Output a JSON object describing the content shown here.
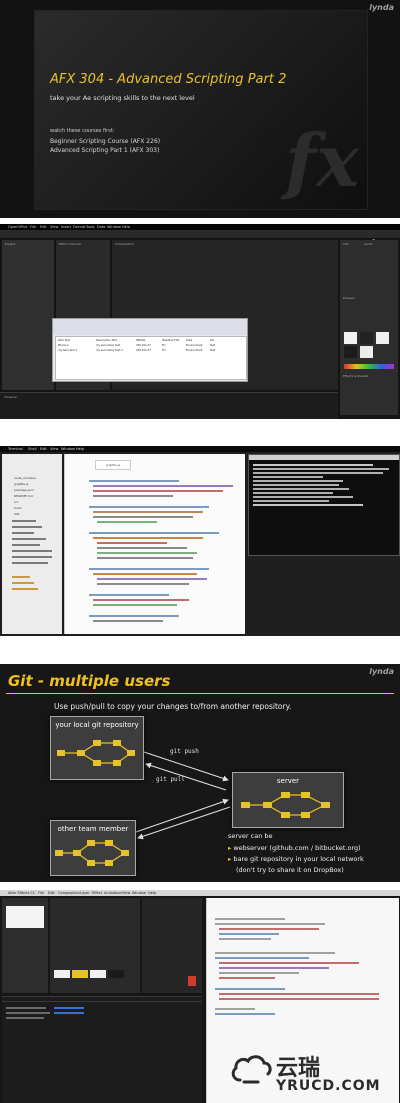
{
  "brand_badge": "lynda",
  "panels": {
    "intro": {
      "title": "AFX 304 - Advanced Scripting Part 2",
      "subtitle": "take your Ae scripting skills to the next level",
      "watch_prompt": "watch these courses first:",
      "courses": [
        "Beginner Scripting Course (AFX 226)",
        "Advanced Scripting Part 1 (AFX 303)"
      ],
      "watermark": "fx",
      "accent": "#e8c22a"
    },
    "spreadsheet": {
      "menu": [
        "OpenOffice",
        "File",
        "Edit",
        "View",
        "Insert",
        "Format",
        "Tools",
        "Data",
        "Window",
        "Help"
      ],
      "sheet_rows": [
        [
          "Item Text",
          "Description Text",
          "IMDate",
          "Headline Fmt",
          "Date",
          "Kw"
        ],
        [
          "Phone A",
          "my secondary text",
          "345,151,27",
          "Fin",
          "Environment",
          "Text"
        ],
        [
          "my item text 2",
          "my secondary text 2",
          "345,151,27",
          "Fin",
          "Environment",
          "Text"
        ]
      ],
      "panel_labels": [
        "Project",
        "Effect Controls",
        "Composition",
        "Timeline",
        "Info",
        "Audio",
        "Preview",
        "Effects & Presets"
      ]
    },
    "code_editor": {
      "menu": [
        "Terminal",
        "Shell",
        "Edit",
        "View",
        "Window",
        "Help"
      ],
      "tab_label": "gulpfile.js",
      "files": [
        "node_modules",
        "gulpfile.js",
        "package.json",
        "README.md",
        "src",
        "build",
        "dist"
      ]
    },
    "git_slide": {
      "heading": "Git - multiple users",
      "instruction": "Use push/pull to copy your changes to/from another repository.",
      "local_repo": "your local git repository",
      "server": "server",
      "team_member": "other team member",
      "push": "git push",
      "pull": "git pull",
      "server_can_be": "server can be",
      "bullet_1": "webserver (github.com / bitbucket.org)",
      "bullet_2": "bare git repository in your local network",
      "bullet_2_note": "(don't try to share it on DropBox)",
      "accent": "#f2c01b"
    },
    "ae_scripting": {
      "menu": [
        "After Effects CC",
        "File",
        "Edit",
        "Composition",
        "Layer",
        "Effect",
        "Animation",
        "View",
        "Window",
        "Help"
      ]
    }
  },
  "logo": {
    "cn": "云瑞",
    "en": "YRUCD.COM"
  }
}
